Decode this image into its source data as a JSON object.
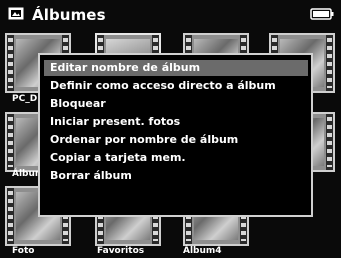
{
  "header": {
    "title": "Álbumes",
    "icon": "album-icon",
    "battery_icon": "battery-icon"
  },
  "thumbnails": [
    {
      "label": "PC_D"
    },
    {
      "label": "Álbum"
    },
    {
      "label": "Foto"
    },
    {
      "label": "Favoritos"
    },
    {
      "label": "Álbum4"
    }
  ],
  "menu": {
    "items": [
      {
        "label": "Editar nombre de álbum",
        "highlighted": true
      },
      {
        "label": "Definir como acceso directo a álbum"
      },
      {
        "label": "Bloquear"
      },
      {
        "label": "Iniciar present. fotos"
      },
      {
        "label": "Ordenar por nombre de álbum"
      },
      {
        "label": "Copiar a tarjeta mem."
      },
      {
        "label": "Borrar álbum"
      }
    ]
  },
  "colors": {
    "background": "#0a0a0a",
    "highlight": "#6b6b6b",
    "text": "#ffffff"
  }
}
